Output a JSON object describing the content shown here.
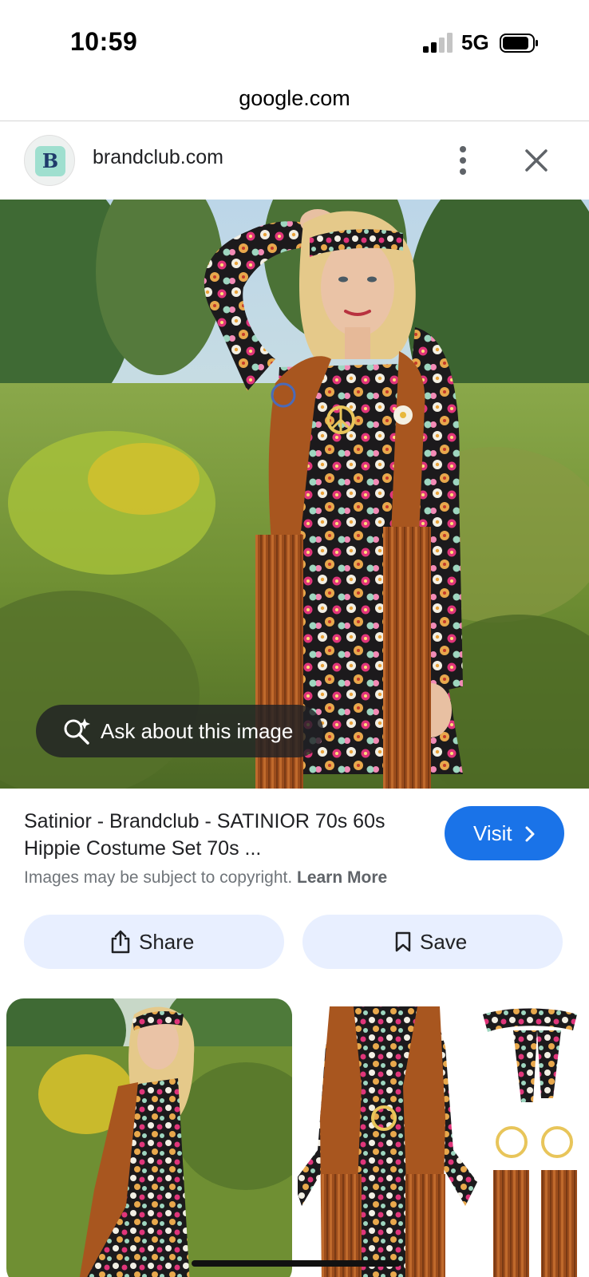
{
  "status_bar": {
    "time": "10:59",
    "network": "5G"
  },
  "browser": {
    "url": "google.com"
  },
  "site": {
    "avatar_letter": "B",
    "name": "brandclub.com"
  },
  "image_overlay": {
    "ask_label": "Ask about this image"
  },
  "result": {
    "title": "Satinior - Brandclub - SATINIOR 70s 60s Hippie Costume Set 70s ...",
    "visit_label": "Visit",
    "copyright_text": "Images may be subject to copyright. ",
    "learn_more_label": "Learn More",
    "share_label": "Share",
    "save_label": "Save"
  },
  "colors": {
    "accent": "#1a73e8",
    "pill_bg": "#e8efff",
    "vest": "#a8561f"
  },
  "icons": [
    "signal-icon",
    "battery-icon",
    "more-vert-icon",
    "close-icon",
    "lens-sparkle-icon",
    "chevron-right-icon",
    "share-icon",
    "bookmark-icon"
  ]
}
